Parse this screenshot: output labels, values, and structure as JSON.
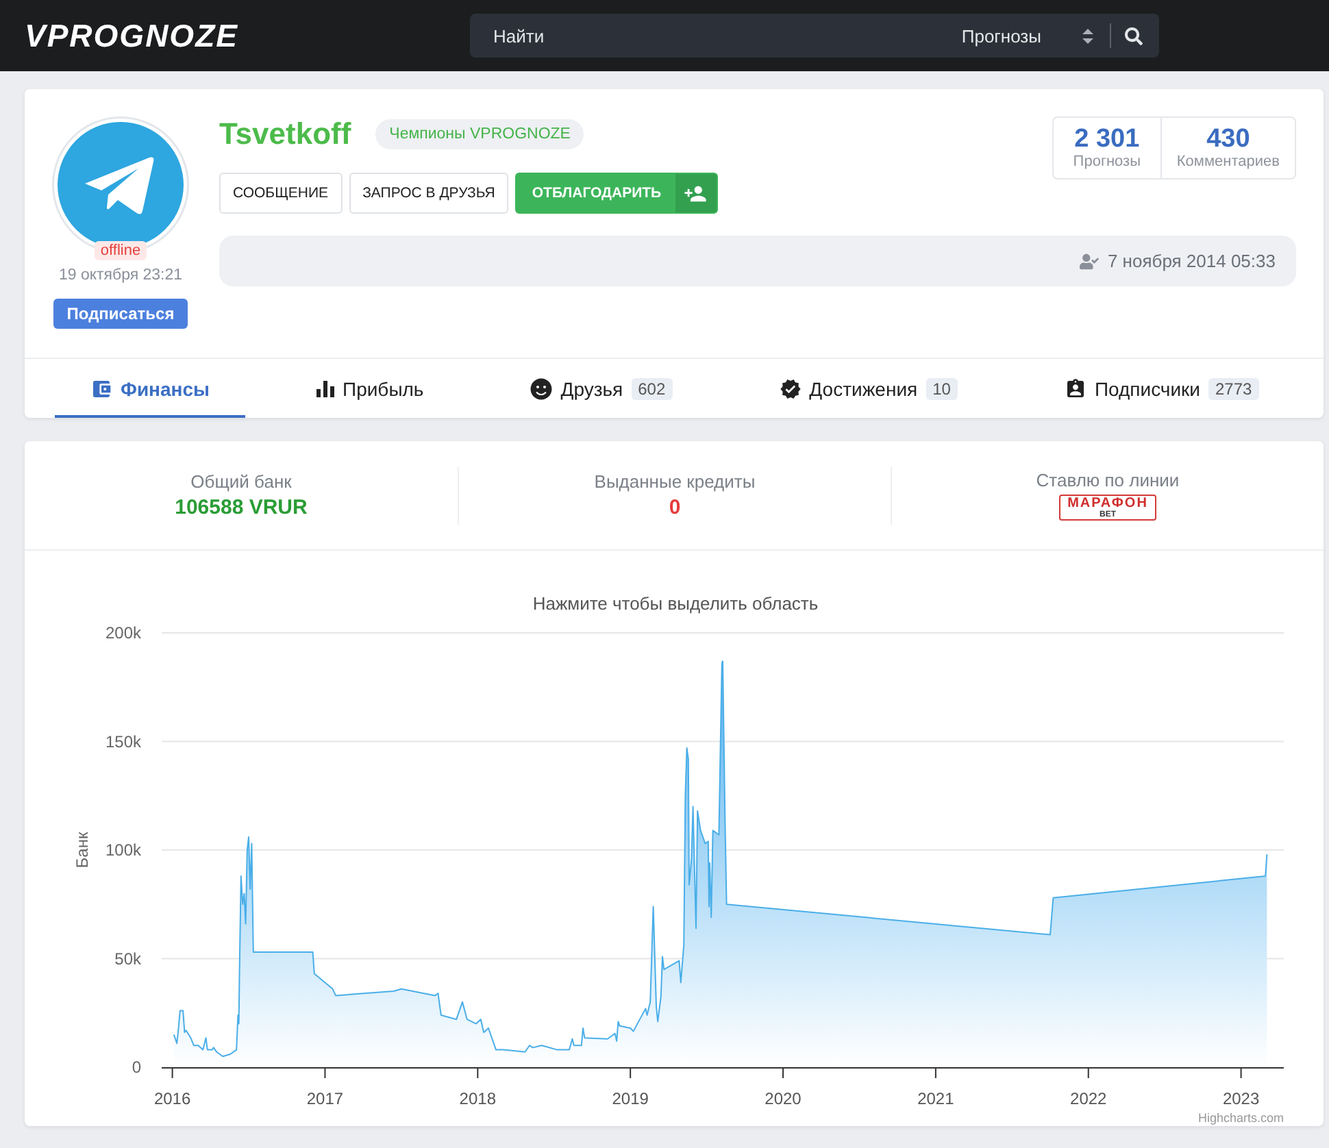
{
  "header": {
    "logo": "VPROGNOZE",
    "search": {
      "placeholder": "Найти",
      "category": "Прогнозы"
    }
  },
  "profile": {
    "username": "Tsvetkoff",
    "badge": "Чемпионы VPROGNOZE",
    "status": "offline",
    "online": false,
    "last_seen": "19 октября 23:21",
    "subscribe_button": "Подписаться",
    "actions": [
      {
        "label": "СООБЩЕНИЕ",
        "kind": "plain"
      },
      {
        "label": "ЗАПРОС В ДРУЗЬЯ",
        "kind": "plain"
      },
      {
        "label": "ОТБЛАГОДАРИТЬ",
        "kind": "primary"
      }
    ],
    "stats": [
      {
        "value": "2 301",
        "label": "Прогнозы"
      },
      {
        "value": "430",
        "label": "Комментариев"
      }
    ],
    "registered": "7 ноября 2014 05:33"
  },
  "tabs": [
    {
      "label": "Финансы",
      "selected": true
    },
    {
      "label": "Прибыль",
      "selected": false
    },
    {
      "label": "Друзья",
      "count": "602",
      "selected": false
    },
    {
      "label": "Достижения",
      "count": "10",
      "selected": false
    },
    {
      "label": "Подписчики",
      "count": "2773",
      "selected": false
    }
  ],
  "finance": {
    "summary": [
      {
        "label": "Общий банк",
        "value": "106588 VRUR",
        "kind": "gain"
      },
      {
        "label": "Выданные кредиты",
        "value": "0",
        "kind": "debt"
      },
      {
        "label": "Ставлю по линии",
        "kind": "logo",
        "logo": {
          "name": "МАРАФОН",
          "sub": "BET"
        }
      }
    ],
    "chart": {
      "credits": "Highcharts.com",
      "chart_data": {
        "type": "area",
        "title": "Нажмите чтобы выделить область",
        "ylabel": "Банк",
        "grid": true,
        "xlim": [
          2015.93,
          2023.28
        ],
        "ylim": [
          0,
          200000
        ],
        "xticks": [
          2016,
          2017,
          2018,
          2019,
          2020,
          2021,
          2022,
          2023
        ],
        "yticks": [
          {
            "value": 0,
            "label": "0"
          },
          {
            "value": 50000,
            "label": "50k"
          },
          {
            "value": 100000,
            "label": "100k"
          },
          {
            "value": 150000,
            "label": "150k"
          },
          {
            "value": 200000,
            "label": "200k"
          }
        ],
        "x": [
          2016.01,
          2016.03,
          2016.04,
          2016.05,
          2016.07,
          2016.08,
          2016.09,
          2016.12,
          2016.14,
          2016.17,
          2016.2,
          2016.22,
          2016.23,
          2016.26,
          2016.27,
          2016.29,
          2016.33,
          2016.38,
          2016.42,
          2016.43,
          2016.435,
          2016.44,
          2016.45,
          2016.46,
          2016.47,
          2016.48,
          2016.49,
          2016.5,
          2016.51,
          2016.52,
          2016.53,
          2016.92,
          2016.93,
          2017.05,
          2017.07,
          2017.45,
          2017.5,
          2017.72,
          2017.74,
          2017.76,
          2017.86,
          2017.9,
          2017.93,
          2017.99,
          2018.02,
          2018.04,
          2018.07,
          2018.12,
          2018.17,
          2018.31,
          2018.34,
          2018.36,
          2018.42,
          2018.52,
          2018.6,
          2018.62,
          2018.63,
          2018.68,
          2018.69,
          2018.7,
          2018.85,
          2018.9,
          2018.91,
          2018.92,
          2018.93,
          2019,
          2019.02,
          2019.1,
          2019.11,
          2019.13,
          2019.15,
          2019.17,
          2019.18,
          2019.2,
          2019.21,
          2019.22,
          2019.32,
          2019.33,
          2019.35,
          2019.36,
          2019.37,
          2019.38,
          2019.385,
          2019.4,
          2019.41,
          2019.43,
          2019.44,
          2019.46,
          2019.49,
          2019.51,
          2019.515,
          2019.52,
          2019.53,
          2019.54,
          2019.58,
          2019.6,
          2019.605,
          2019.62,
          2019.63,
          2021.75,
          2021.77,
          2023.16,
          2023.17
        ],
        "values": [
          15000,
          11000,
          18000,
          26000,
          26000,
          16000,
          17000,
          13500,
          10000,
          10000,
          8000,
          13500,
          8000,
          8000,
          9000,
          7000,
          5000,
          6000,
          8000,
          24000,
          20000,
          44000,
          88000,
          75000,
          80000,
          66000,
          100000,
          106000,
          82000,
          103000,
          53000,
          53000,
          43000,
          36000,
          33000,
          35000,
          36000,
          33000,
          34000,
          24000,
          22000,
          30000,
          22000,
          20000,
          22000,
          16000,
          18000,
          8000,
          8000,
          7000,
          10000,
          9000,
          10000,
          8000,
          8000,
          13000,
          10000,
          10000,
          18000,
          13500,
          13000,
          15500,
          12000,
          21000,
          19000,
          18000,
          16500,
          27000,
          24000,
          30000,
          74000,
          28000,
          21000,
          32500,
          51000,
          45000,
          49000,
          39000,
          56000,
          125000,
          147000,
          142000,
          84000,
          96000,
          120000,
          64000,
          118000,
          109000,
          103000,
          104000,
          74000,
          94000,
          69000,
          109000,
          107000,
          186000,
          187000,
          113000,
          75000,
          61000,
          78000,
          88000,
          98000
        ]
      }
    }
  }
}
